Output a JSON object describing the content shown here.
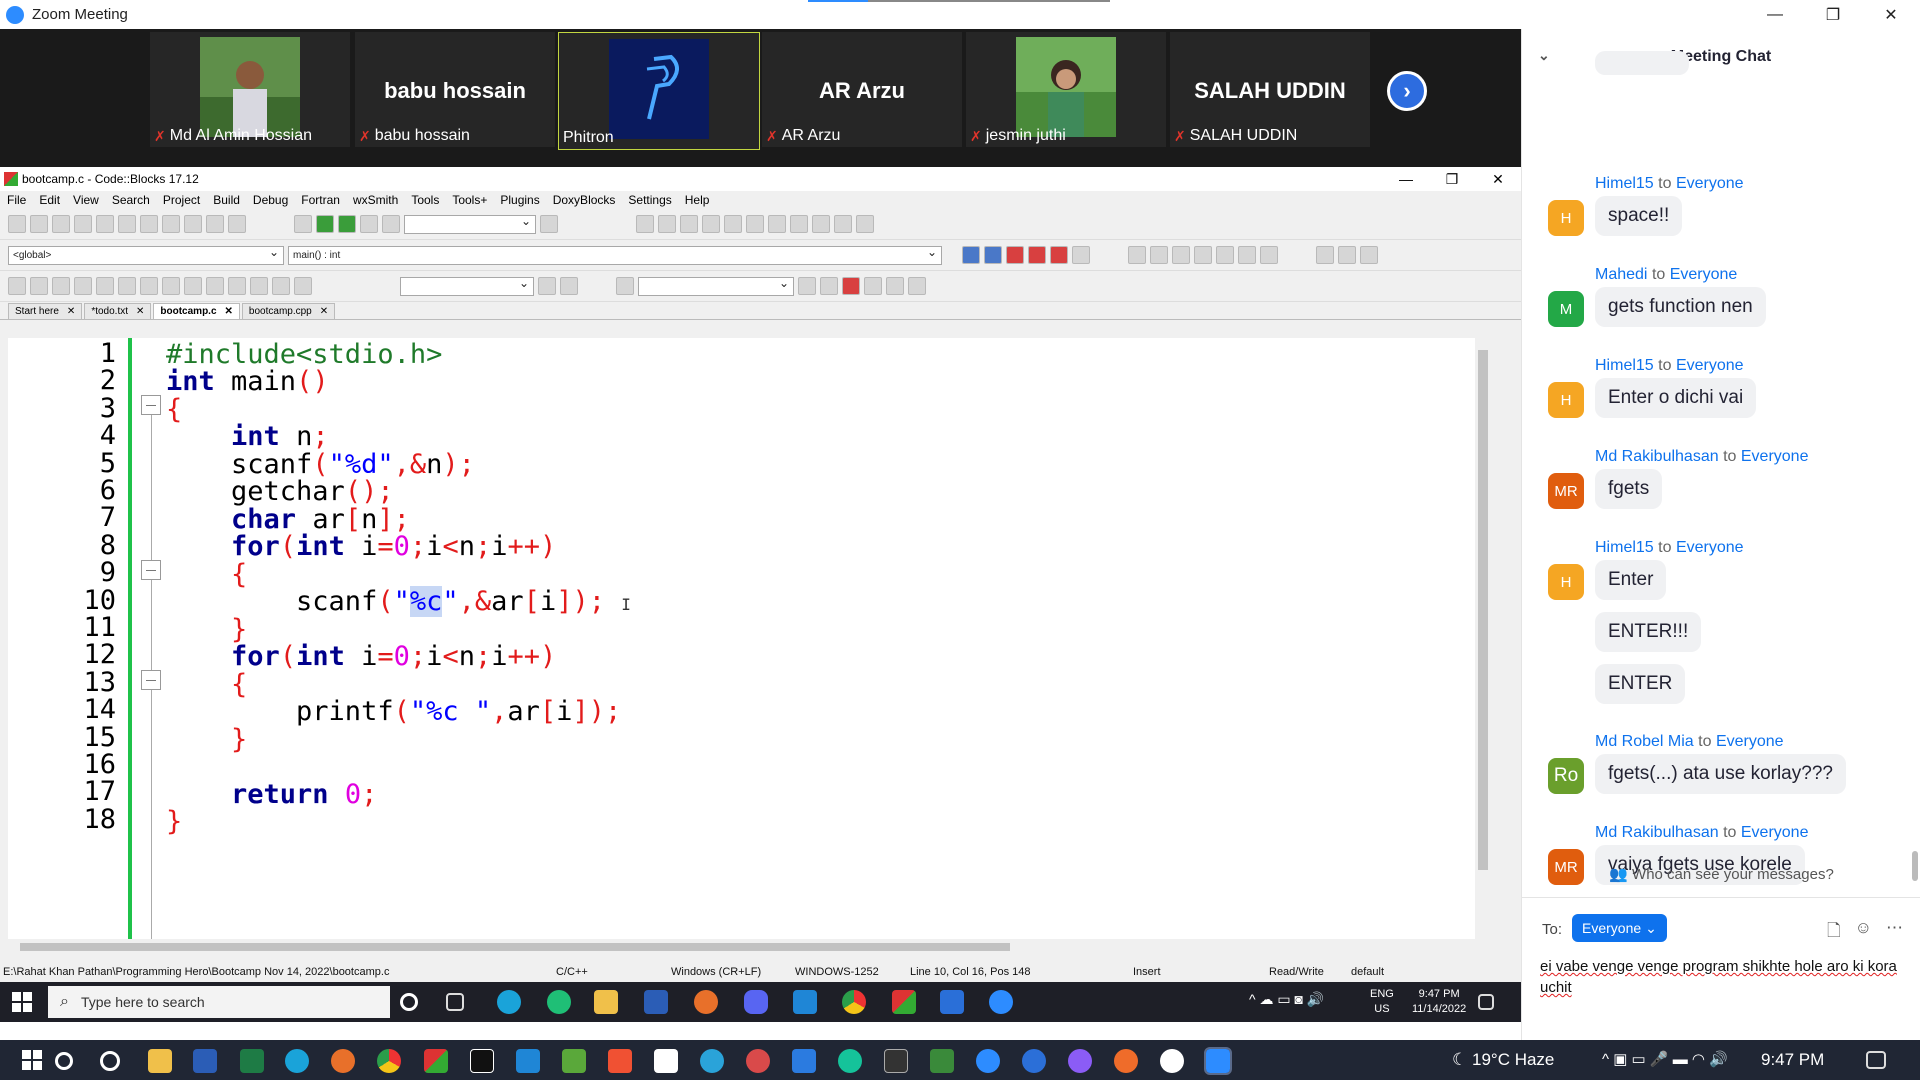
{
  "zoom": {
    "title": "Zoom Meeting",
    "participants": [
      {
        "name": "Md Al Amin Hossian",
        "big": "",
        "muted": true
      },
      {
        "name": "babu hossain",
        "big": "babu hossain",
        "muted": true
      },
      {
        "name": "Phitron",
        "big": "",
        "muted": false
      },
      {
        "name": "AR Arzu",
        "big": "AR Arzu",
        "muted": true
      },
      {
        "name": "jesmin juthi",
        "big": "",
        "muted": true
      },
      {
        "name": "SALAH UDDIN",
        "big": "SALAH UDDIN",
        "muted": true
      }
    ]
  },
  "codeblocks": {
    "title": "bootcamp.c - Code::Blocks 17.12",
    "menu": [
      "File",
      "Edit",
      "View",
      "Search",
      "Project",
      "Build",
      "Debug",
      "Fortran",
      "wxSmith",
      "Tools",
      "Tools+",
      "Plugins",
      "DoxyBlocks",
      "Settings",
      "Help"
    ],
    "scope": "<global>",
    "function": "main() : int",
    "tabs": [
      "Start here",
      "*todo.txt",
      "bootcamp.c",
      "bootcamp.cpp"
    ],
    "line_numbers": [
      "1",
      "2",
      "3",
      "4",
      "5",
      "6",
      "7",
      "8",
      "9",
      "10",
      "11",
      "12",
      "13",
      "14",
      "15",
      "16",
      "17",
      "18"
    ],
    "status": {
      "path": "E:\\Rahat Khan Pathan\\Programming Hero\\Bootcamp Nov 14, 2022\\bootcamp.c",
      "lang": "C/C++",
      "eol": "Windows (CR+LF)",
      "encoding": "WINDOWS-1252",
      "position": "Line 10, Col 16, Pos 148",
      "mode": "Insert",
      "access": "Read/Write",
      "profile": "default"
    }
  },
  "taskbar_inner": {
    "search_placeholder": "Type here to search",
    "lang": "ENG",
    "region": "US",
    "time": "9:47 PM",
    "date": "11/14/2022"
  },
  "taskbar_outer": {
    "weather": "19°C Haze",
    "time": "9:47 PM"
  },
  "chat": {
    "title": "Meeting Chat",
    "messages": [
      {
        "sender": "Himel15",
        "to": "Everyone",
        "initials": "H",
        "color": "#f5a623",
        "lines": [
          "space!!"
        ]
      },
      {
        "sender": "Mahedi",
        "to": "Everyone",
        "initials": "M",
        "color": "#23a847",
        "lines": [
          "gets function nen"
        ]
      },
      {
        "sender": "Himel15",
        "to": "Everyone",
        "initials": "H",
        "color": "#f5a623",
        "lines": [
          "Enter o dichi vai"
        ]
      },
      {
        "sender": "Md Rakibulhasan",
        "to": "Everyone",
        "initials": "MR",
        "color": "#e05d0e",
        "lines": [
          "fgets"
        ]
      },
      {
        "sender": "Himel15",
        "to": "Everyone",
        "initials": "H",
        "color": "#f5a623",
        "lines": [
          "Enter",
          "ENTER!!!",
          "ENTER"
        ]
      },
      {
        "sender": "Md Robel Mia",
        "to": "Everyone",
        "initials": "Ro",
        "color": "#6a9f2c",
        "lines": [
          "fgets(...) ata use korlay???"
        ]
      },
      {
        "sender": "Md Rakibulhasan",
        "to": "Everyone",
        "initials": "MR",
        "color": "#e05d0e",
        "lines": [
          "vaiya fgets use korele"
        ]
      }
    ],
    "to_word": "to",
    "who_can_see": "Who can see your messages?",
    "to_label": "To:",
    "recipient": "Everyone",
    "draft": "ei vabe venge venge program shikhte hole aro ki kora uchit"
  }
}
